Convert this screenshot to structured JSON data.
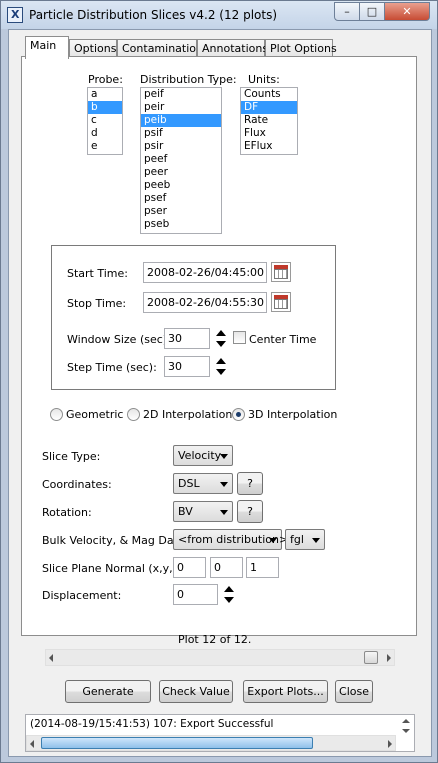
{
  "window": {
    "title": "Particle Distribution Slices v4.2  (12 plots)",
    "min": "–",
    "max": "□",
    "close": "✕"
  },
  "tabs": [
    {
      "label": "Main"
    },
    {
      "label": "Options"
    },
    {
      "label": "Contamination"
    },
    {
      "label": "Annotations"
    },
    {
      "label": "Plot Options"
    }
  ],
  "probe": {
    "label": "Probe:",
    "items": [
      "a",
      "b",
      "c",
      "d",
      "e"
    ],
    "selected": "b"
  },
  "dist": {
    "label": "Distribution Type:",
    "items": [
      "peif",
      "peir",
      "peib",
      "psif",
      "psir",
      "peef",
      "peer",
      "peeb",
      "psef",
      "pser",
      "pseb"
    ],
    "selected": "peib"
  },
  "units": {
    "label": "Units:",
    "items": [
      "Counts",
      "DF",
      "Rate",
      "Flux",
      "EFlux"
    ],
    "selected": "DF"
  },
  "time": {
    "start_label": "Start Time:",
    "start_value": "2008-02-26/04:45:00",
    "stop_label": "Stop Time:",
    "stop_value": "2008-02-26/04:55:30",
    "window_label": "Window Size (sec):",
    "window_value": "30",
    "center_label": "Center Time",
    "step_label": "Step Time (sec):",
    "step_value": "30"
  },
  "method": {
    "geometric": "Geometric",
    "interp2d": "2D Interpolation",
    "interp3d": "3D Interpolation",
    "selected": "3D Interpolation"
  },
  "slice": {
    "type_label": "Slice Type:",
    "type_value": "Velocity",
    "coord_label": "Coordinates:",
    "coord_value": "DSL",
    "rot_label": "Rotation:",
    "rot_value": "BV",
    "bulk_label": "Bulk Velocity, & Mag Data:",
    "bulk_value": "<from distribution>",
    "mag_value": "fgl",
    "normal_label": "Slice Plane Normal (x,y,z):",
    "normal_x": "0",
    "normal_y": "0",
    "normal_z": "1",
    "disp_label": "Displacement:",
    "disp_value": "0",
    "help": "?"
  },
  "plot_counter": "Plot 12 of 12.",
  "buttons": {
    "generate": "Generate",
    "check": "Check Value",
    "export": "Export Plots...",
    "close": "Close"
  },
  "status": {
    "message": "(2014-08-19/15:41:53) 107: Export Successful"
  },
  "colors": {
    "selection": "#3399ff",
    "close_button": "#c74c34"
  }
}
